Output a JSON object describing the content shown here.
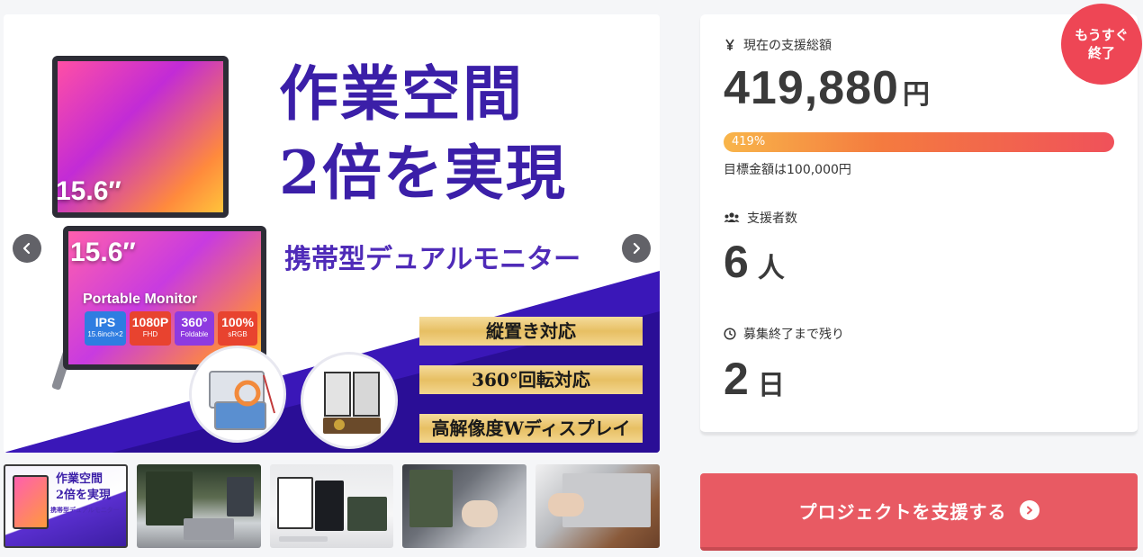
{
  "gallery": {
    "size_top": "15.6″",
    "size_bottom": "15.6″",
    "portable_label": "Portable Monitor",
    "specs": [
      {
        "main": "IPS",
        "sub": "15.6inch×2"
      },
      {
        "main": "1080P",
        "sub": "FHD"
      },
      {
        "main": "360°",
        "sub": "Foldable"
      },
      {
        "main": "100%",
        "sub": "sRGB"
      }
    ],
    "headline_line1": "作業空間",
    "headline_line2": "2倍を実現",
    "subheadline": "携帯型デュアルモニター",
    "features": [
      "縦置き対応",
      "360°回転対応",
      "高解像度Wディスプレイ"
    ],
    "prev_icon": "chevron-left-icon",
    "next_icon": "chevron-right-icon"
  },
  "thumbnails": {
    "t1_title_1": "作業空間",
    "t1_title_2": "2倍を実現",
    "t1_title_3": "携帯型デュアルモニター"
  },
  "stats": {
    "amount_label": "現在の支援総額",
    "amount_icon": "yen-icon",
    "amount_value": "419,880",
    "amount_unit": "円",
    "progress_percent": 419,
    "progress_text": "419%",
    "goal_text": "目標金額は100,000円",
    "backers_label": "支援者数",
    "backers_icon": "people-icon",
    "backers_value": "6",
    "backers_unit": "人",
    "remaining_label": "募集終了まで残り",
    "remaining_icon": "clock-icon",
    "remaining_value": "2",
    "remaining_unit": "日"
  },
  "badge": {
    "line1": "もうすぐ",
    "line2": "終了",
    "color": "#ee4655"
  },
  "support_button": {
    "label": "プロジェクトを支援する",
    "icon": "arrow-right-circle-icon",
    "color": "#e85a63"
  }
}
